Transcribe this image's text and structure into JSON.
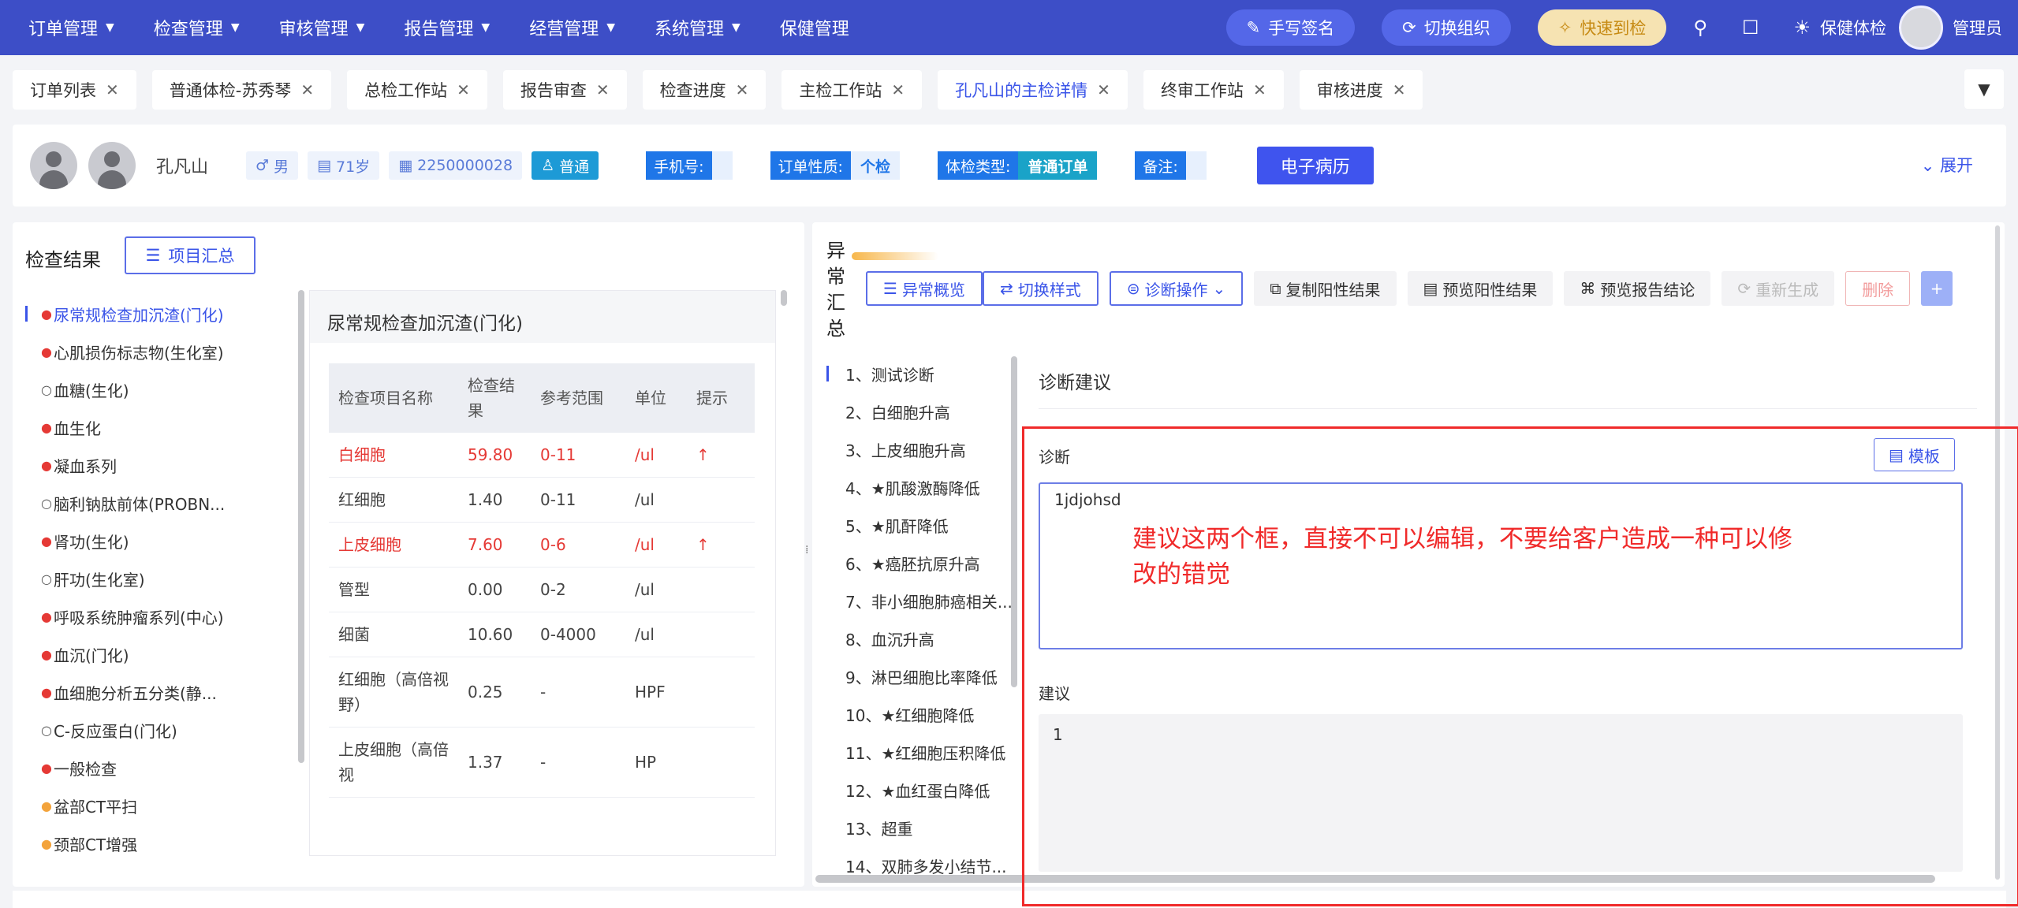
{
  "nav": {
    "menus": [
      {
        "label": "订单管理"
      },
      {
        "label": "检查管理"
      },
      {
        "label": "审核管理"
      },
      {
        "label": "报告管理"
      },
      {
        "label": "经营管理"
      },
      {
        "label": "系统管理"
      },
      {
        "label": "保健管理"
      }
    ],
    "sign_label": "手写签名",
    "switch_org_label": "切换组织",
    "quick_label": "快速到检",
    "org_name": "保健体检",
    "user_name": "管理员"
  },
  "tabs": [
    {
      "label": "订单列表"
    },
    {
      "label": "普通体检-苏秀琴"
    },
    {
      "label": "总检工作站"
    },
    {
      "label": "报告审查"
    },
    {
      "label": "检查进度"
    },
    {
      "label": "主检工作站"
    },
    {
      "label": "孔凡山的主检详情"
    },
    {
      "label": "终审工作站"
    },
    {
      "label": "审核进度"
    }
  ],
  "patient": {
    "name": "孔凡山",
    "gender": "男",
    "age": "71岁",
    "id": "2250000028",
    "level": "普通",
    "phone_label": "手机号:",
    "phone_value": "",
    "order_nature_label": "订单性质:",
    "order_nature_value": "个检",
    "exam_type_label": "体检类型:",
    "exam_type_value": "普通订单",
    "remark_label": "备注:",
    "remark_value": "",
    "emr_label": "电子病历",
    "expand_label": "展开"
  },
  "left": {
    "title": "检查结果",
    "summary_button": "项目汇总",
    "items": [
      {
        "label": "尿常规检查加沉渣(门化)",
        "status": "red"
      },
      {
        "label": "心肌损伤标志物(生化室)",
        "status": "red"
      },
      {
        "label": "血糖(生化)",
        "status": "empty"
      },
      {
        "label": "血生化",
        "status": "red"
      },
      {
        "label": "凝血系列",
        "status": "red"
      },
      {
        "label": "脑利钠肽前体(PROBN...",
        "status": "empty"
      },
      {
        "label": "肾功(生化)",
        "status": "red"
      },
      {
        "label": "肝功(生化室)",
        "status": "empty"
      },
      {
        "label": "呼吸系统肿瘤系列(中心)",
        "status": "red"
      },
      {
        "label": "血沉(门化)",
        "status": "red"
      },
      {
        "label": "血细胞分析五分类(静...",
        "status": "red"
      },
      {
        "label": "C-反应蛋白(门化)",
        "status": "empty"
      },
      {
        "label": "一般检查",
        "status": "red"
      },
      {
        "label": "盆部CT平扫",
        "status": "orange"
      },
      {
        "label": "颈部CT增强",
        "status": "orange"
      }
    ],
    "card_title": "尿常规检查加沉渣(门化)",
    "table_headers": [
      "检查项目名称",
      "检查结果",
      "参考范围",
      "单位",
      "提示"
    ],
    "rows": [
      {
        "name": "白细胞",
        "result": "59.80",
        "range": "0-11",
        "unit": "/ul",
        "flag": "↑",
        "abnormal": true
      },
      {
        "name": "红细胞",
        "result": "1.40",
        "range": "0-11",
        "unit": "/ul",
        "flag": "",
        "abnormal": false
      },
      {
        "name": "上皮细胞",
        "result": "7.60",
        "range": "0-6",
        "unit": "/ul",
        "flag": "↑",
        "abnormal": true
      },
      {
        "name": "管型",
        "result": "0.00",
        "range": "0-2",
        "unit": "/ul",
        "flag": "",
        "abnormal": false
      },
      {
        "name": "细菌",
        "result": "10.60",
        "range": "0-4000",
        "unit": "/ul",
        "flag": "",
        "abnormal": false
      },
      {
        "name": "红细胞（高倍视野）",
        "result": "0.25",
        "range": "-",
        "unit": "HPF",
        "flag": "",
        "abnormal": false
      },
      {
        "name": "上皮细胞（高倍视",
        "result": "1.37",
        "range": "-",
        "unit": "HP",
        "flag": "",
        "abnormal": false
      }
    ]
  },
  "right": {
    "title": "异常汇总",
    "toolbar": {
      "overview": "异常概览",
      "switch_style": "切换样式",
      "diag_ops": "诊断操作",
      "copy_positive": "复制阳性结果",
      "preview_positive": "预览阳性结果",
      "preview_conclusion": "预览报告结论",
      "regenerate": "重新生成",
      "delete": "删除",
      "add": "+"
    },
    "diagnoses": [
      "1、测试诊断",
      "2、白细胞升高",
      "3、上皮细胞升高",
      "4、★肌酸激酶降低",
      "5、★肌酐降低",
      "6、★癌胚抗原升高",
      "7、非小细胞肺癌相关...",
      "8、血沉升高",
      "9、淋巴细胞比率降低",
      "10、★红细胞降低",
      "11、★红细胞压积降低",
      "12、★血红蛋白降低",
      "13、超重",
      "14、双肺多发小结节..."
    ],
    "section_title": "诊断建议",
    "diag_label": "诊断",
    "template_button": "模板",
    "diag_value": "1jdjohsd",
    "advice_label": "建议",
    "advice_value": "1"
  },
  "annotation": {
    "text": "建议这两个框，直接不可以编辑，不要给客户造成一种可以修改的错觉",
    "color": "#f02a2a"
  },
  "colors": {
    "nav_bg": "#3d4ec7",
    "primary": "#3a54e8",
    "danger": "#e53935",
    "status_red": "#e53935",
    "status_orange": "#f3a33b"
  }
}
